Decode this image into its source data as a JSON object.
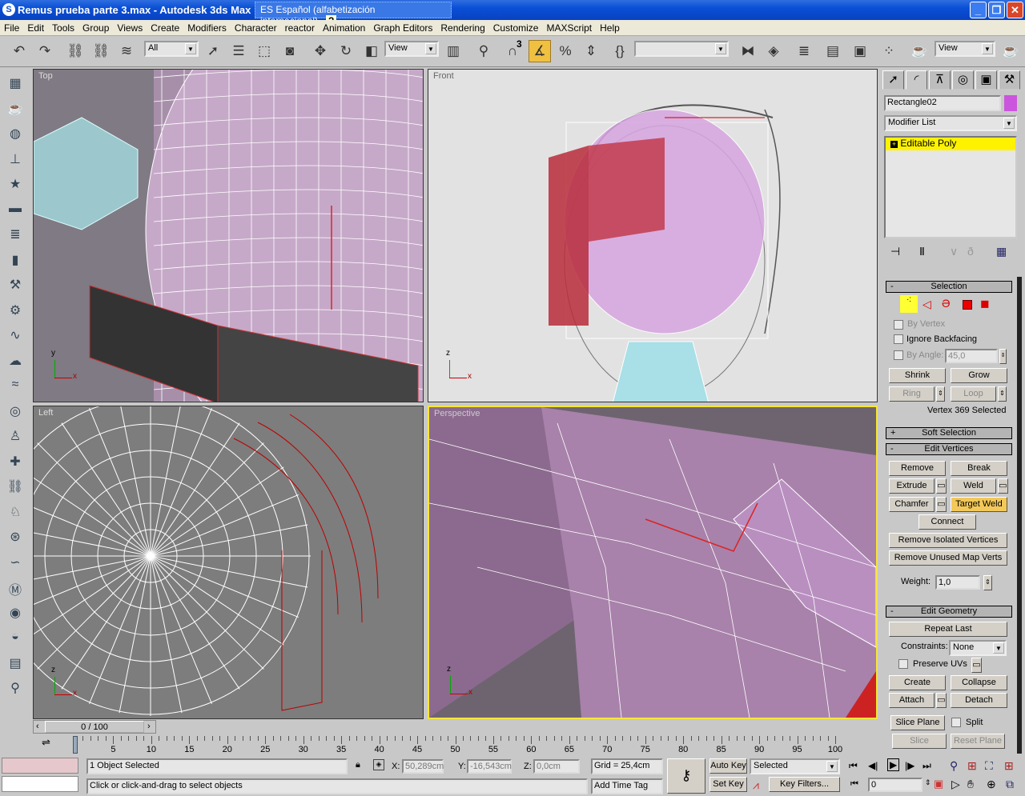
{
  "window": {
    "title": "Remus prueba parte 3.max - Autodesk 3ds Max",
    "language_bar": "ES Español (alfabetización internacional)",
    "minimize": "_",
    "restore": "❐",
    "close": "✕"
  },
  "menu": [
    "File",
    "Edit",
    "Tools",
    "Group",
    "Views",
    "Create",
    "Modifiers",
    "Character",
    "reactor",
    "Animation",
    "Graph Editors",
    "Rendering",
    "Customize",
    "MAXScript",
    "Help"
  ],
  "toolbar": {
    "selection_filter": "All",
    "ref_coord_1": "View",
    "named_selection": "",
    "ref_coord_2": "View",
    "snap_label": "3",
    "icons": [
      "undo-icon",
      "redo-icon",
      "select-link-icon",
      "unlink-icon",
      "bind-space-warp-icon",
      "select-icon",
      "select-by-name-icon",
      "rect-region-icon",
      "window-crossing-icon",
      "move-icon",
      "rotate-icon",
      "scale-icon",
      "pivot-icon",
      "manipulate-icon",
      "snap-icon",
      "angle-snap-icon",
      "percent-snap-icon",
      "spinner-snap-icon",
      "edit-named-selections-icon",
      "mirror-icon",
      "align-icon",
      "layer-manager-icon",
      "curve-editor-icon",
      "schematic-view-icon",
      "material-editor-icon",
      "render-scene-icon",
      "quick-render-icon"
    ],
    "active_icon": "angle-snap-icon"
  },
  "left_tools": [
    "box-icon",
    "teapot-icon",
    "sphere-icon",
    "cone-icon",
    "star-icon",
    "plane-icon",
    "stack-icon",
    "cylinder-icon",
    "tool-icon",
    "gear-icon",
    "spring-icon",
    "fog-icon",
    "waves-icon",
    "ring-icon",
    "biped-icon",
    "bone-icon",
    "link-icon",
    "chair-icon",
    "wheel-icon",
    "rope-icon",
    "mt-icon",
    "camera-icon",
    "bonnet-icon",
    "notes-icon",
    "zoom-region-icon"
  ],
  "viewports": {
    "top": "Top",
    "front": "Front",
    "left": "Left",
    "perspective": "Perspective",
    "axis_x": "x",
    "axis_y": "y",
    "axis_z": "z"
  },
  "command_panel": {
    "tabs": [
      "create-tab",
      "modify-tab",
      "hierarchy-tab",
      "motion-tab",
      "display-tab",
      "utilities-tab"
    ],
    "object_name": "Rectangle02",
    "object_color": "#cc55dd",
    "modifier_list": "Modifier List",
    "stack_item": "Editable Poly",
    "selection": {
      "title": "Selection",
      "by_vertex": "By Vertex",
      "ignore_backfacing": "Ignore Backfacing",
      "by_angle": "By Angle:",
      "angle_value": "45,0",
      "shrink": "Shrink",
      "grow": "Grow",
      "ring": "Ring",
      "loop": "Loop",
      "status": "Vertex 369 Selected"
    },
    "soft_selection": "Soft Selection",
    "edit_vertices": {
      "title": "Edit Vertices",
      "remove": "Remove",
      "break": "Break",
      "extrude": "Extrude",
      "weld": "Weld",
      "chamfer": "Chamfer",
      "target_weld": "Target Weld",
      "connect": "Connect",
      "remove_isolated": "Remove Isolated Vertices",
      "remove_unused": "Remove Unused Map Verts",
      "weight_label": "Weight:",
      "weight_value": "1,0"
    },
    "edit_geometry": {
      "title": "Edit Geometry",
      "repeat_last": "Repeat Last",
      "constraints_label": "Constraints:",
      "constraints_value": "None",
      "preserve_uvs": "Preserve UVs",
      "create": "Create",
      "collapse": "Collapse",
      "attach": "Attach",
      "detach": "Detach",
      "slice_plane": "Slice Plane",
      "split": "Split",
      "slice": "Slice",
      "reset_plane": "Reset Plane"
    }
  },
  "timeline": {
    "frame_slider": "0 / 100",
    "current": 0,
    "end": 100,
    "labels": [
      "0",
      "5",
      "10",
      "15",
      "20",
      "25",
      "30",
      "35",
      "40",
      "45",
      "50",
      "55",
      "60",
      "65",
      "70",
      "75",
      "80",
      "85",
      "90",
      "95",
      "100"
    ]
  },
  "status": {
    "selection": "1 Object Selected",
    "prompt": "Click or click-and-drag to select objects",
    "x_label": "X:",
    "x": "50,289cm",
    "y_label": "Y:",
    "y": "-16,543cm",
    "z_label": "Z:",
    "z": "0,0cm",
    "grid": "Grid = 25,4cm",
    "add_time_tag": "Add Time Tag",
    "auto_key": "Auto Key",
    "set_key": "Set Key",
    "key_mode": "Selected",
    "key_filters": "Key Filters...",
    "frame": "0"
  }
}
